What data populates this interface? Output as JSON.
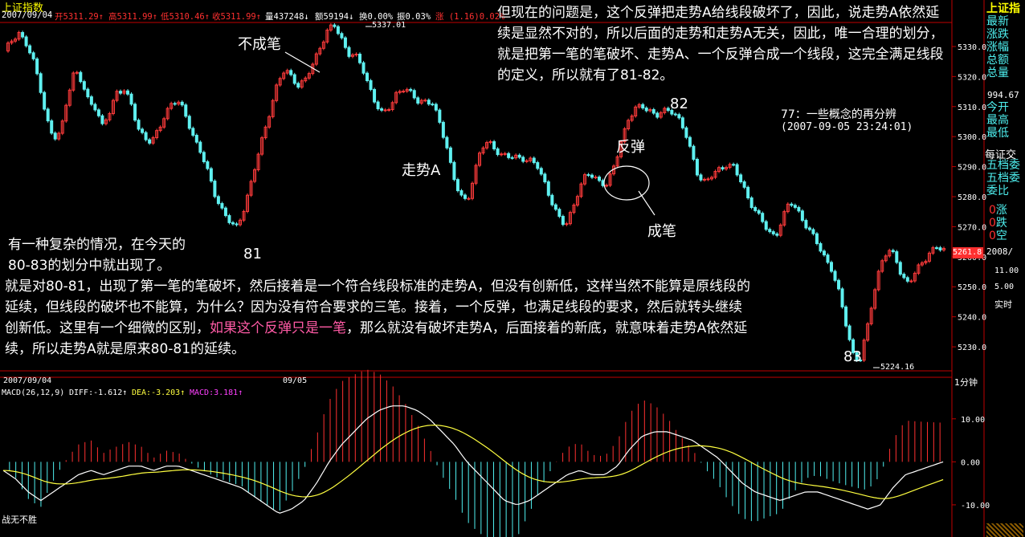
{
  "colors": {
    "up": "#ff3b3b",
    "down": "#5ff0f0",
    "axis": "#c00000",
    "text_white": "#ffffff",
    "text_yellow": "#ffff00",
    "text_magenta": "#ff40ff",
    "text_cyan": "#4ff0f0",
    "text_red": "#ff3030",
    "annotation_pink": "#ff5aa5",
    "macd_red": "#ff3030",
    "macd_cyan": "#4ff0f0",
    "diff_white": "#ffffff",
    "dea_yellow": "#ffff40"
  },
  "header": {
    "index_name": "上证指数",
    "date": "2007/09/04",
    "open": "开5311.29↑",
    "high": "高5311.99↑",
    "low": "低5310.46↑",
    "close": "收5311.99↑",
    "volume": "量437248↓",
    "amount": "额59194↓",
    "turnover": "换0.00%",
    "amplitude": "振0.03%",
    "change": "涨 (1.16)0.02%"
  },
  "price_axis": {
    "ticks": [
      "5330.0",
      "5320.0",
      "5310.0",
      "5300.0",
      "5290.0",
      "5280.0",
      "5270.0",
      "5260.0",
      "5250.0",
      "5240.0",
      "5230.0"
    ],
    "current_value": "5261.8",
    "max_label": "5337.01",
    "min_label": "5224.16"
  },
  "macd_panel": {
    "date_left": "2007/09/04",
    "date_mid": "09/05",
    "period": "1分钟",
    "params": "MACD(26,12,9)",
    "diff": "DIFF:-1.612↑",
    "dea": "DEA:-3.203↑",
    "macd": "MACD:3.181↑",
    "axis_ticks": [
      "10.00",
      "0.00",
      "-10.00"
    ]
  },
  "right_panel": {
    "title": "上证指",
    "rows": [
      "最新",
      "涨跌",
      "涨幅",
      "总额",
      "总量"
    ],
    "value": "994.67",
    "rows2": [
      "今开",
      "最高",
      "最低"
    ],
    "label3": "每证交",
    "rows3": [
      "五档委",
      "五档委",
      "委比"
    ],
    "updown_rows": [
      "涨",
      "跌",
      "空"
    ],
    "updown_values": [
      "0",
      "0",
      "0"
    ],
    "date": "2008/",
    "vol_ticks": [
      "11.00",
      "5.00"
    ],
    "realtime": "实时"
  },
  "annotations": {
    "buchengbi": "不成笔",
    "zoushi": "走势A",
    "fantan": "反弹",
    "chengbi": "成笔",
    "label81": "81",
    "label82": "82",
    "label83": "83",
    "note_title": "77：一些概念的再分辨",
    "note_time": "(2007-09-05 23:24:01)",
    "top_para": "但现在的问题是，这个反弹把走势A给线段破坏了，因此，说走势A依然延续是显然不对的，所以后面的走势和走势A无关，因此，唯一合理的划分，就是把第一笔的笔破坏、走势A、一个反弹合成一个线段，这完全满足线段的定义，所以就有了81-82。",
    "para1_line1": "有一种复杂的情况，在今天的",
    "para1_line2": "80-83的划分中就出现了。",
    "para2_a": "就是对80-81，出现了第一笔的笔破坏，然后接着是一个符合线段标准的走势A，但没有创新低，这样当然不能算是原线段的延续，但线段的破坏也不能算，为什么？因为没有符合要求的三笔。接着，一个反弹，也满足线段的要求，然后就转头继续创新低。这里有一个细微的区别，",
    "para2_pink": "如果这个反弹只是一笔",
    "para2_b": "，那么就没有破坏走势A，后面接着的新底，就意味着走势A依然延续，所以走势A就是原来80-81的延续。",
    "watermark": "战无不胜"
  },
  "chart_data": [
    {
      "type": "candlestick",
      "title": "上证指数",
      "interval": "1分钟",
      "ylim": [
        5222,
        5338
      ],
      "y_ticks": [
        5230,
        5240,
        5250,
        5260,
        5270,
        5280,
        5290,
        5300,
        5310,
        5320,
        5330
      ],
      "x": [
        "2007/09/04",
        "09/05"
      ],
      "key_points": [
        {
          "label": "81",
          "value": 5269
        },
        {
          "label": "82",
          "value": 5311
        },
        {
          "label": "83",
          "value": 5224.16
        }
      ],
      "max": 5337.01,
      "min": 5224.16,
      "close_path": [
        5328,
        5332,
        5335,
        5331,
        5326,
        5318,
        5306,
        5299,
        5301,
        5314,
        5322,
        5318,
        5312,
        5310,
        5303,
        5308,
        5315,
        5316,
        5311,
        5303,
        5300,
        5298,
        5302,
        5308,
        5312,
        5311,
        5306,
        5300,
        5295,
        5288,
        5281,
        5276,
        5272,
        5269,
        5275,
        5283,
        5292,
        5301,
        5310,
        5318,
        5322,
        5320,
        5317,
        5319,
        5324,
        5330,
        5335,
        5337,
        5333,
        5328,
        5327,
        5323,
        5317,
        5311,
        5307,
        5310,
        5315,
        5316,
        5314,
        5312,
        5312,
        5311,
        5305,
        5298,
        5287,
        5280,
        5278,
        5288,
        5296,
        5298,
        5296,
        5294,
        5293,
        5293,
        5293,
        5292,
        5290,
        5285,
        5279,
        5273,
        5270,
        5276,
        5283,
        5287,
        5287,
        5285,
        5284,
        5290,
        5299,
        5306,
        5309,
        5310,
        5309,
        5307,
        5308,
        5309,
        5307,
        5302,
        5294,
        5287,
        5285,
        5287,
        5289,
        5291,
        5290,
        5285,
        5280,
        5276,
        5272,
        5268,
        5267,
        5273,
        5278,
        5276,
        5272,
        5268,
        5264,
        5260,
        5256,
        5248,
        5238,
        5228,
        5225,
        5235,
        5248,
        5258,
        5262,
        5260,
        5254,
        5251,
        5255,
        5258,
        5262,
        5263,
        5262
      ]
    },
    {
      "type": "line",
      "title": "MACD(26,12,9)",
      "ylim": [
        -13,
        15
      ],
      "y_ticks": [
        -10,
        0,
        10
      ],
      "series": [
        {
          "name": "DIFF",
          "last": -1.612
        },
        {
          "name": "DEA",
          "last": -3.203
        },
        {
          "name": "MACD",
          "last": 3.181
        }
      ],
      "diff_path": [
        -2,
        -4,
        -7,
        -9,
        -7,
        -5,
        -3,
        -2,
        -3,
        -2,
        -1,
        -1,
        -2,
        -1,
        -1,
        -2,
        -3,
        -4,
        -5,
        -6,
        -8,
        -10,
        -12,
        -11,
        -9,
        -5,
        0,
        4,
        7,
        10,
        12,
        13,
        13,
        12,
        10,
        7,
        4,
        0,
        -3,
        -6,
        -9,
        -10,
        -9,
        -7,
        -5,
        -3,
        -2,
        -3,
        -3,
        -1,
        3,
        6,
        7,
        7,
        6,
        5,
        3,
        1,
        -2,
        -5,
        -7,
        -8,
        -9,
        -8,
        -7,
        -7,
        -8,
        -9,
        -10,
        -11,
        -10,
        -6,
        -3,
        -2,
        -1,
        0
      ]
    }
  ]
}
